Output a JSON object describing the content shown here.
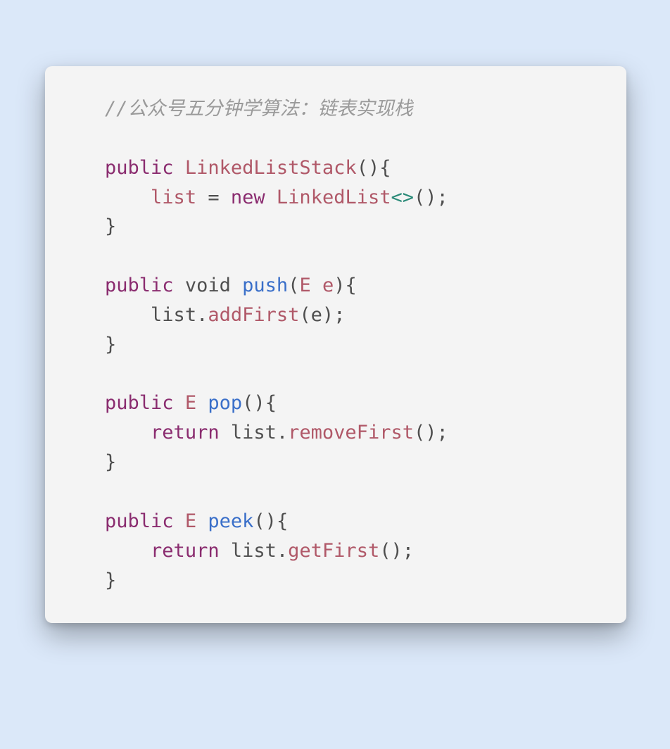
{
  "code": {
    "indent1": "    ",
    "indent2": "        ",
    "comment": "//公众号五分钟学算法：链表实现栈",
    "kw_public": "public",
    "kw_void": "void",
    "kw_return": "return",
    "kw_new": "new",
    "type_LinkedListStack": "LinkedListStack",
    "type_LinkedList": "LinkedList",
    "type_E": "E",
    "id_list": "list",
    "fn_push": "push",
    "fn_pop": "pop",
    "fn_peek": "peek",
    "call_addFirst": "addFirst",
    "call_removeFirst": "removeFirst",
    "call_getFirst": "getFirst",
    "id_e": "e",
    "angle_open": "<",
    "angle_close": ">",
    "p_open": "(",
    "p_close": ")",
    "b_open": "{",
    "b_close": "}",
    "semi": ";",
    "dot": ".",
    "sp": " ",
    "eq": "=",
    "blank": ""
  }
}
